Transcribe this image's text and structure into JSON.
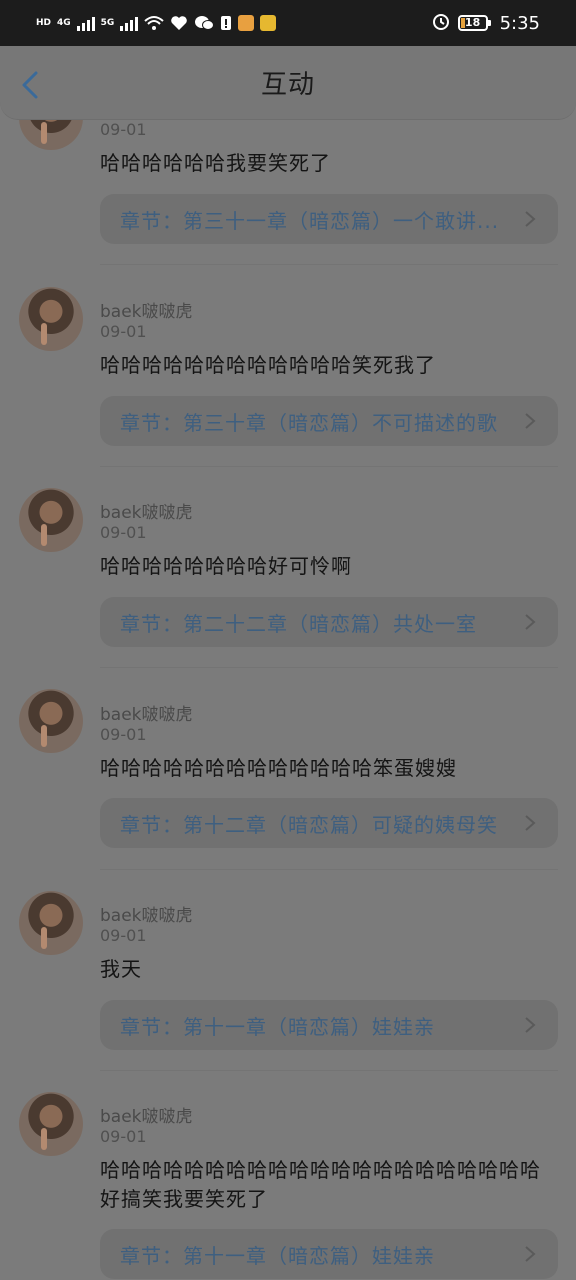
{
  "status_bar": {
    "left_tags": [
      "HD",
      "4G",
      "5G"
    ],
    "time": "5:35",
    "battery": "18"
  },
  "header": {
    "title": "互动"
  },
  "comments": [
    {
      "username": "",
      "date": "09-01",
      "content": "哈哈哈哈哈哈我要笑死了",
      "chapter": "章节：第三十一章（暗恋篇）一个敢讲..."
    },
    {
      "username": "baek啵啵虎",
      "date": "09-01",
      "content": "哈哈哈哈哈哈哈哈哈哈哈哈笑死我了",
      "chapter": "章节：第三十章（暗恋篇）不可描述的歌"
    },
    {
      "username": "baek啵啵虎",
      "date": "09-01",
      "content": "哈哈哈哈哈哈哈哈好可怜啊",
      "chapter": "章节：第二十二章（暗恋篇）共处一室"
    },
    {
      "username": "baek啵啵虎",
      "date": "09-01",
      "content": "哈哈哈哈哈哈哈哈哈哈哈哈哈笨蛋嫂嫂",
      "chapter": "章节：第十二章（暗恋篇）可疑的姨母笑"
    },
    {
      "username": "baek啵啵虎",
      "date": "09-01",
      "content": "我天",
      "chapter": "章节：第十一章（暗恋篇）娃娃亲"
    },
    {
      "username": "baek啵啵虎",
      "date": "09-01",
      "content": "哈哈哈哈哈哈哈哈哈哈哈哈哈哈哈哈哈哈哈哈哈好搞笑我要笑死了",
      "chapter": "章节：第十一章（暗恋篇）娃娃亲"
    }
  ],
  "colors": {
    "overlay_bg": "#7b7b7b",
    "chapter_text": "#3e5f80",
    "back_icon": "#3a6a9a"
  },
  "icons": [
    "back-arrow-icon",
    "chevron-right-icon",
    "alarm-icon",
    "wifi-icon",
    "battery-icon"
  ]
}
